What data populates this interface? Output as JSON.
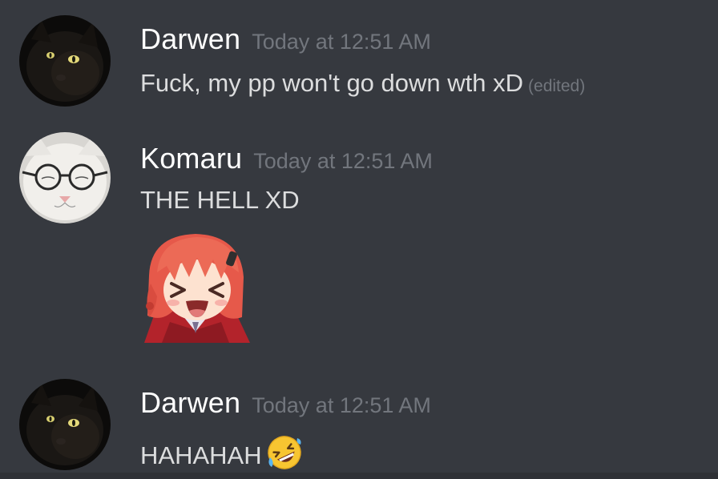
{
  "messages": [
    {
      "username": "Darwen",
      "timestamp": "Today at 12:51 AM",
      "content": "Fuck, my pp won't go down wth xD",
      "edited_label": "(edited)",
      "avatar_icon": "black-cat-avatar"
    },
    {
      "username": "Komaru",
      "timestamp": "Today at 12:51 AM",
      "content": "THE HELL XD",
      "avatar_icon": "white-cat-with-glasses-avatar",
      "sticker_icon": "laughing-anime-girl-sticker"
    },
    {
      "username": "Darwen",
      "timestamp": "Today at 12:51 AM",
      "content": "HAHAHAH",
      "avatar_icon": "black-cat-avatar",
      "emoji_icon": "rolling-on-floor-laughing-icon"
    }
  ],
  "colors": {
    "background": "#36393f",
    "username": "#ffffff",
    "timestamp": "#72767d",
    "message_text": "#dcddde"
  }
}
